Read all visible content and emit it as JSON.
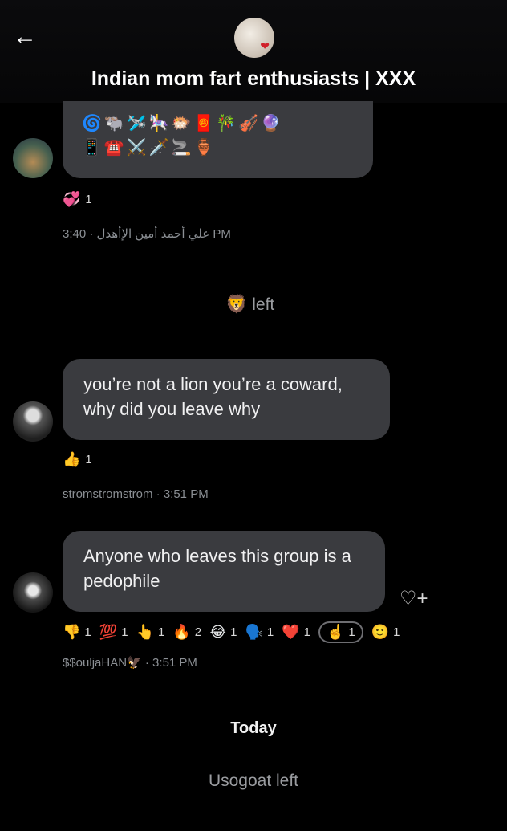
{
  "header": {
    "back_icon": "←",
    "title": "Indian mom fart enthusiasts | XXX"
  },
  "messages": [
    {
      "emoji_line1": "🌀🐃🛩️🎠🐡🧧🎋🎻🔮",
      "emoji_line2": "📱☎️⚔️🗡️🚬🏺",
      "reaction_emoji": "💞",
      "reaction_count": "1",
      "meta": "علي أحمد أمين الإأهدل · 3:40 PM"
    },
    {
      "system_icon": "🦁",
      "system_text": "left"
    },
    {
      "text": "you’re not a lion you’re a coward, why did you leave why",
      "reaction_emoji": "👍",
      "reaction_count": "1",
      "meta": "stromstromstrom · 3:51 PM"
    },
    {
      "text": "Anyone who leaves this group is a pedophile",
      "add_reaction_icon": "♡+",
      "reactions": [
        {
          "emoji": "👎",
          "count": "1"
        },
        {
          "emoji": "💯",
          "count": "1"
        },
        {
          "emoji": "👆",
          "count": "1"
        },
        {
          "emoji": "🔥",
          "count": "2"
        },
        {
          "emoji": "😂",
          "count": "1"
        },
        {
          "emoji": "🗣️",
          "count": "1"
        },
        {
          "emoji": "❤️",
          "count": "1"
        },
        {
          "emoji": "☝️",
          "count": "1",
          "selected": true
        },
        {
          "emoji": "🙂",
          "count": "1"
        }
      ],
      "meta": "$$ouljaHAN🦅 · 3:51 PM"
    }
  ],
  "divider": "Today",
  "last_system": "Usogoat left"
}
